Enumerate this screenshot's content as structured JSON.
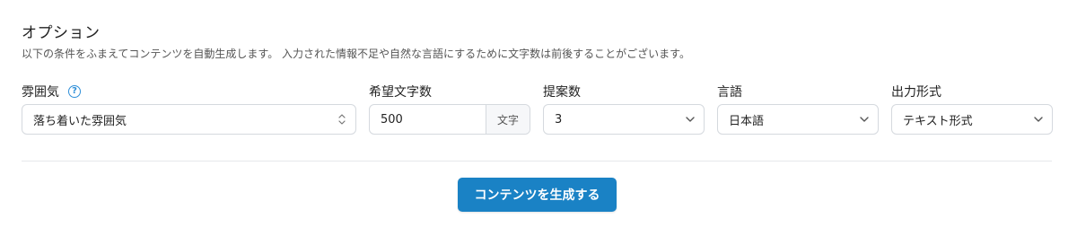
{
  "options": {
    "title": "オプション",
    "description": "以下の条件をふまえてコンテンツを自動生成します。 入力された情報不足や自然な言語にするために文字数は前後することがございます。"
  },
  "fields": {
    "atmosphere": {
      "label": "雰囲気",
      "help_icon": "?",
      "value": "落ち着いた雰囲気"
    },
    "char_count": {
      "label": "希望文字数",
      "value": "500",
      "unit": "文字"
    },
    "proposal_count": {
      "label": "提案数",
      "value": "3"
    },
    "language": {
      "label": "言語",
      "value": "日本語"
    },
    "output_format": {
      "label": "出力形式",
      "value": "テキスト形式"
    }
  },
  "actions": {
    "generate_label": "コンテンツを生成する"
  },
  "colors": {
    "accent": "#1a82c5",
    "help_icon": "#2f8fd8",
    "border": "#d5d9de"
  }
}
